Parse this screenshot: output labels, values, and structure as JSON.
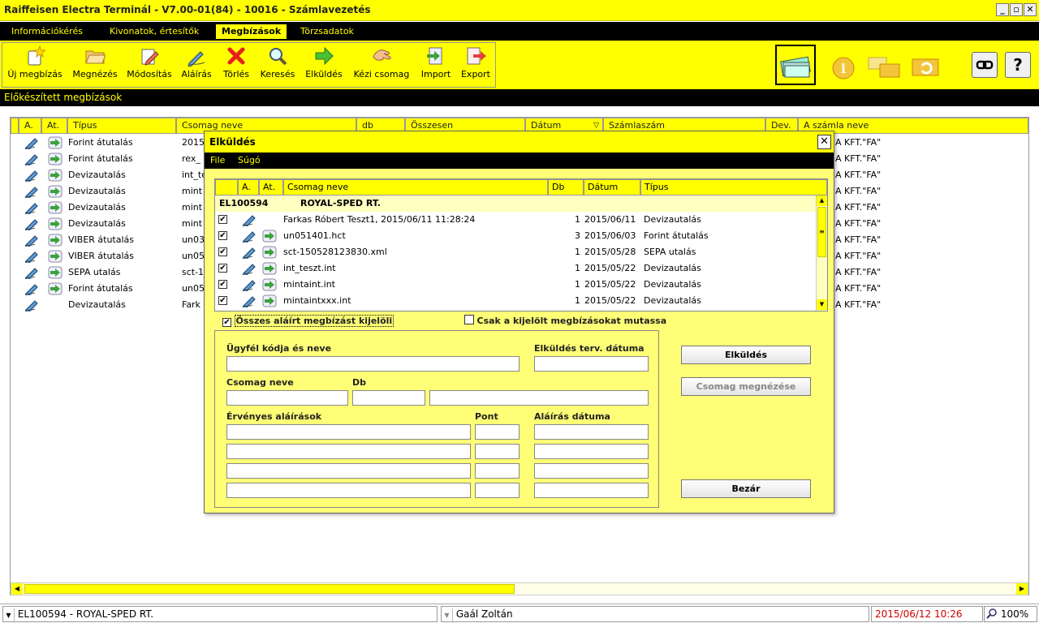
{
  "window": {
    "title": "Raiffeisen Electra Terminál - V7.00-01(84) - 10016 - Számlavezetés",
    "min": "_",
    "restore": "▫",
    "close": "✕"
  },
  "menu": [
    "Információkérés",
    "Kivonatok, értesítők",
    "Megbízások",
    "Törzsadatok"
  ],
  "toolbar": {
    "buttons": [
      {
        "label": "Új megbízás",
        "icon": "new-document-icon"
      },
      {
        "label": "Megnézés",
        "icon": "folder-open-icon"
      },
      {
        "label": "Módosítás",
        "icon": "edit-pencil-icon"
      },
      {
        "label": "Aláírás",
        "icon": "sign-pen-icon"
      },
      {
        "label": "Törlés",
        "icon": "delete-x-icon"
      },
      {
        "label": "Keresés",
        "icon": "magnifier-icon"
      },
      {
        "label": "Elküldés",
        "icon": "send-arrow-icon"
      },
      {
        "label": "Kézi csomag",
        "icon": "hand-package-icon"
      },
      {
        "label": "Import",
        "icon": "import-icon"
      },
      {
        "label": "Export",
        "icon": "export-icon"
      }
    ],
    "link_icon": "link-icon",
    "help_label": "?"
  },
  "section_title": "Előkészített megbízások",
  "main_table": {
    "headers": [
      "A.",
      "At.",
      "Típus",
      "Csomag neve",
      "db",
      "Összesen",
      "Dátum",
      "Számlaszám",
      "Dev.",
      "A számla neve"
    ],
    "sort_indicator": "▽",
    "rows": [
      {
        "type": "Forint átutalás",
        "pkg": "2015",
        "name": "A KFT.\"FA\"",
        "at": true
      },
      {
        "type": "Forint átutalás",
        "pkg": "rex_",
        "name": "A KFT.\"FA\"",
        "at": true
      },
      {
        "type": "Devizautalás",
        "pkg": "int_te",
        "name": "A KFT.\"FA\"",
        "at": true
      },
      {
        "type": "Devizautalás",
        "pkg": "mint",
        "name": "A KFT.\"FA\"",
        "at": true
      },
      {
        "type": "Devizautalás",
        "pkg": "mint",
        "name": "A KFT.\"FA\"",
        "at": true
      },
      {
        "type": "Devizautalás",
        "pkg": "mint",
        "name": "A KFT.\"FA\"",
        "at": true
      },
      {
        "type": "VIBER átutalás",
        "pkg": "un03",
        "name": "A KFT.\"FA\"",
        "at": true
      },
      {
        "type": "VIBER átutalás",
        "pkg": "un05",
        "name": "A KFT.\"FA\"",
        "at": true
      },
      {
        "type": "SEPA utalás",
        "pkg": "sct-1",
        "name": "A KFT.\"FA\"",
        "at": true
      },
      {
        "type": "Forint átutalás",
        "pkg": "un05",
        "name": "A KFT.\"FA\"",
        "at": true
      },
      {
        "type": "Devizautalás",
        "pkg": "Fark",
        "name": "A KFT.\"FA\"",
        "at": false
      }
    ]
  },
  "dialog": {
    "title": "Elküldés",
    "close": "✕",
    "menu": [
      "File",
      "Súgó"
    ],
    "table": {
      "headers": [
        "A.",
        "At.",
        "Csomag neve",
        "Db",
        "Dátum",
        "Típus"
      ],
      "group": {
        "code": "EL100594",
        "name": "ROYAL-SPED RT."
      },
      "rows": [
        {
          "checked": "✔",
          "name": "Farkas Róbert Teszt1, 2015/06/11 11:28:24",
          "db": "1",
          "date": "2015/06/11",
          "type": "Devizautalás",
          "at": false
        },
        {
          "checked": "✔",
          "name": "un051401.hct",
          "db": "3",
          "date": "2015/06/03",
          "type": "Forint átutalás",
          "at": true
        },
        {
          "checked": "✔",
          "name": "sct-150528123830.xml",
          "db": "1",
          "date": "2015/05/28",
          "type": "SEPA utalás",
          "at": true
        },
        {
          "checked": "✔",
          "name": "int_teszt.int",
          "db": "1",
          "date": "2015/05/22",
          "type": "Devizautalás",
          "at": true
        },
        {
          "checked": "✔",
          "name": "mintaint.int",
          "db": "1",
          "date": "2015/05/22",
          "type": "Devizautalás",
          "at": true
        },
        {
          "checked": "✔",
          "name": "mintaintxxx.int",
          "db": "1",
          "date": "2015/05/22",
          "type": "Devizautalás",
          "at": true
        }
      ]
    },
    "select_all": {
      "checked": "✔",
      "label": "Összes aláírt megbízást kijelöli"
    },
    "show_selected": {
      "checked": "",
      "label": "Csak a kijelölt megbízásokat mutassa"
    },
    "form": {
      "client_label": "Ügyfél kódja és neve",
      "send_date_label": "Elküldés terv. dátuma",
      "pkg_label": "Csomag neve",
      "db_label": "Db",
      "sig_label": "Érvényes aláírások",
      "point_label": "Pont",
      "sig_date_label": "Aláírás dátuma"
    },
    "buttons": {
      "send": "Elküldés",
      "view": "Csomag megnézése",
      "close": "Bezár"
    }
  },
  "statusbar": {
    "account": "EL100594 - ROYAL-SPED RT.",
    "user": "Gaál Zoltán",
    "datetime": "2015/06/12 10:26",
    "zoom": "100%"
  },
  "colors": {
    "accent": "#ffff00",
    "dark": "#000000",
    "dialog_bg": "#ffff77",
    "datetime": "#cc0000"
  }
}
